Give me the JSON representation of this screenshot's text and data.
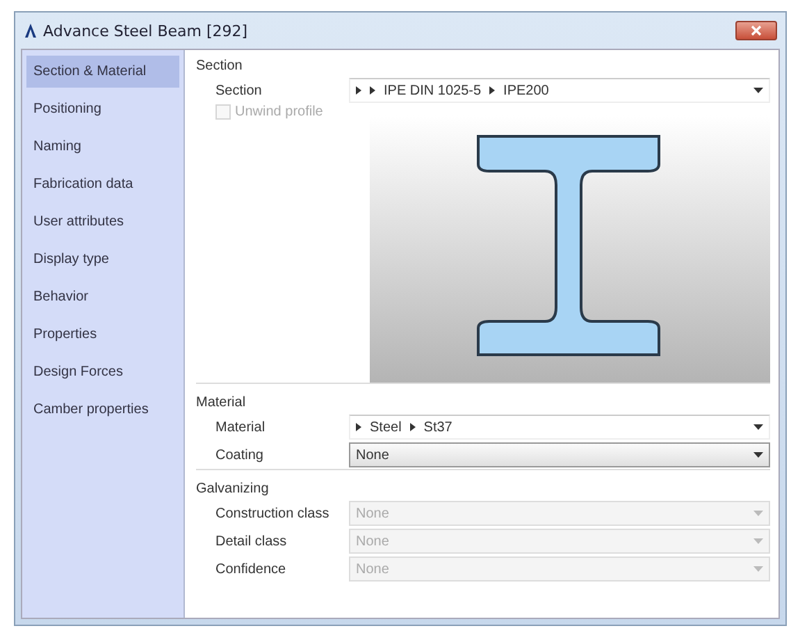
{
  "window": {
    "title": "Advance Steel  Beam [292]"
  },
  "sidebar": {
    "items": [
      {
        "label": "Section & Material",
        "selected": true
      },
      {
        "label": "Positioning",
        "selected": false
      },
      {
        "label": "Naming",
        "selected": false
      },
      {
        "label": "Fabrication data",
        "selected": false
      },
      {
        "label": "User attributes",
        "selected": false
      },
      {
        "label": "Display type",
        "selected": false
      },
      {
        "label": "Behavior",
        "selected": false
      },
      {
        "label": "Properties",
        "selected": false
      },
      {
        "label": "Design Forces",
        "selected": false
      },
      {
        "label": "Camber properties",
        "selected": false
      }
    ]
  },
  "section_group": {
    "title": "Section",
    "section": {
      "label": "Section",
      "path": [
        {
          "kind": "arrow"
        },
        {
          "kind": "arrow"
        },
        {
          "kind": "text",
          "text": "IPE DIN 1025-5"
        },
        {
          "kind": "arrow"
        },
        {
          "kind": "text",
          "text": "IPE200"
        }
      ]
    },
    "unwind_profile": {
      "label": "Unwind profile",
      "checked": false,
      "disabled": true
    }
  },
  "material_group": {
    "title": "Material",
    "fields": [
      {
        "kind": "path",
        "label": "Material",
        "path": [
          {
            "kind": "arrow"
          },
          {
            "kind": "text",
            "text": "Steel"
          },
          {
            "kind": "arrow"
          },
          {
            "kind": "text",
            "text": "St37"
          }
        ],
        "disabled": false
      },
      {
        "kind": "select",
        "label": "Coating",
        "value": "None",
        "disabled": false
      }
    ]
  },
  "galvanizing_group": {
    "title": "Galvanizing",
    "fields": [
      {
        "kind": "select",
        "label": "Construction class",
        "value": "None",
        "disabled": true
      },
      {
        "kind": "select",
        "label": "Detail class",
        "value": "None",
        "disabled": true
      },
      {
        "kind": "select",
        "label": "Confidence",
        "value": "None",
        "disabled": true
      }
    ]
  }
}
